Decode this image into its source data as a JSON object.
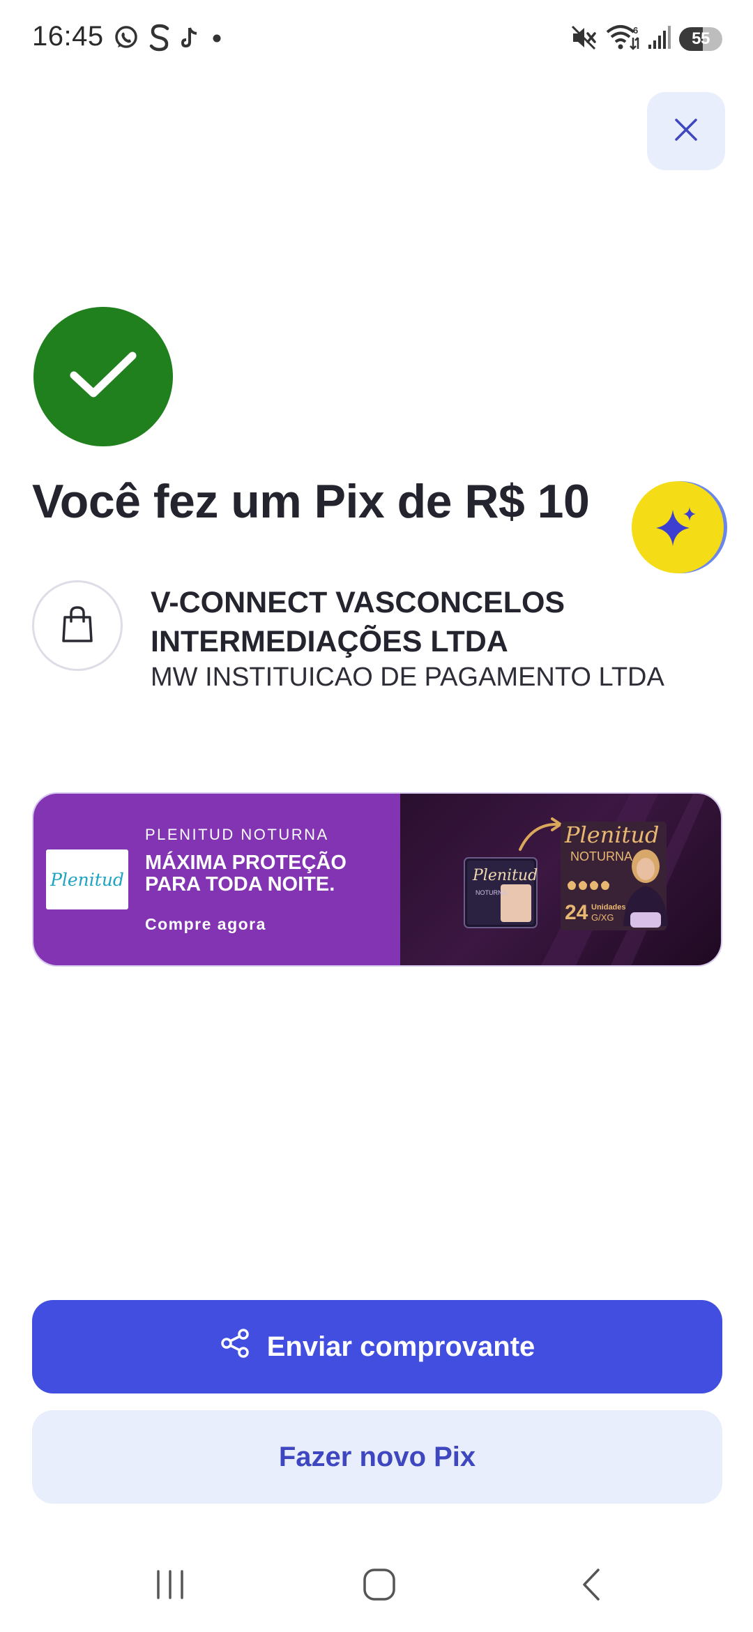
{
  "status_bar": {
    "time": "16:45",
    "battery": "55",
    "left_icons": [
      "whatsapp-icon",
      "s-app-icon",
      "tiktok-icon",
      "dot-icon"
    ],
    "right_icons": [
      "mute-icon",
      "wifi-icon",
      "signal-icon",
      "battery-icon"
    ]
  },
  "header": {
    "close_icon": "close-icon"
  },
  "result": {
    "status_icon": "check-icon",
    "title": "Você fez um Pix de R$ 10",
    "ai_icon": "sparkle-icon"
  },
  "recipient": {
    "icon": "shopping-bag-icon",
    "name": "V-CONNECT VASCONCELOS INTERMEDIAÇÕES LTDA",
    "institution": "MW INSTITUICAO DE PAGAMENTO LTDA"
  },
  "ad": {
    "logo_text": "Plenitud",
    "eyebrow": "PLENITUD NOTURNA",
    "headline": "MÁXIMA PROTEÇÃO\nPARA TODA NOITE.",
    "cta": "Compre agora",
    "product_brand": "Plenitud",
    "product_line": "NOTURNA",
    "product_count": "24",
    "product_unit": "Unidades",
    "product_size": "G/XG",
    "colors": {
      "left_bg": "#8234b3",
      "right_bg": "#2a0f2f",
      "logo_text": "#1fa3c2"
    }
  },
  "actions": {
    "send_receipt_label": "Enviar comprovante",
    "send_receipt_icon": "share-icon",
    "new_pix_label": "Fazer novo Pix"
  },
  "nav": {
    "recents_icon": "recents-icon",
    "home_icon": "home-icon",
    "back_icon": "back-icon"
  },
  "colors": {
    "primary": "#424ee0",
    "secondary_bg": "#e8eefb",
    "success": "#21801e",
    "ai_yellow": "#f4dc16",
    "text": "#23242e"
  }
}
